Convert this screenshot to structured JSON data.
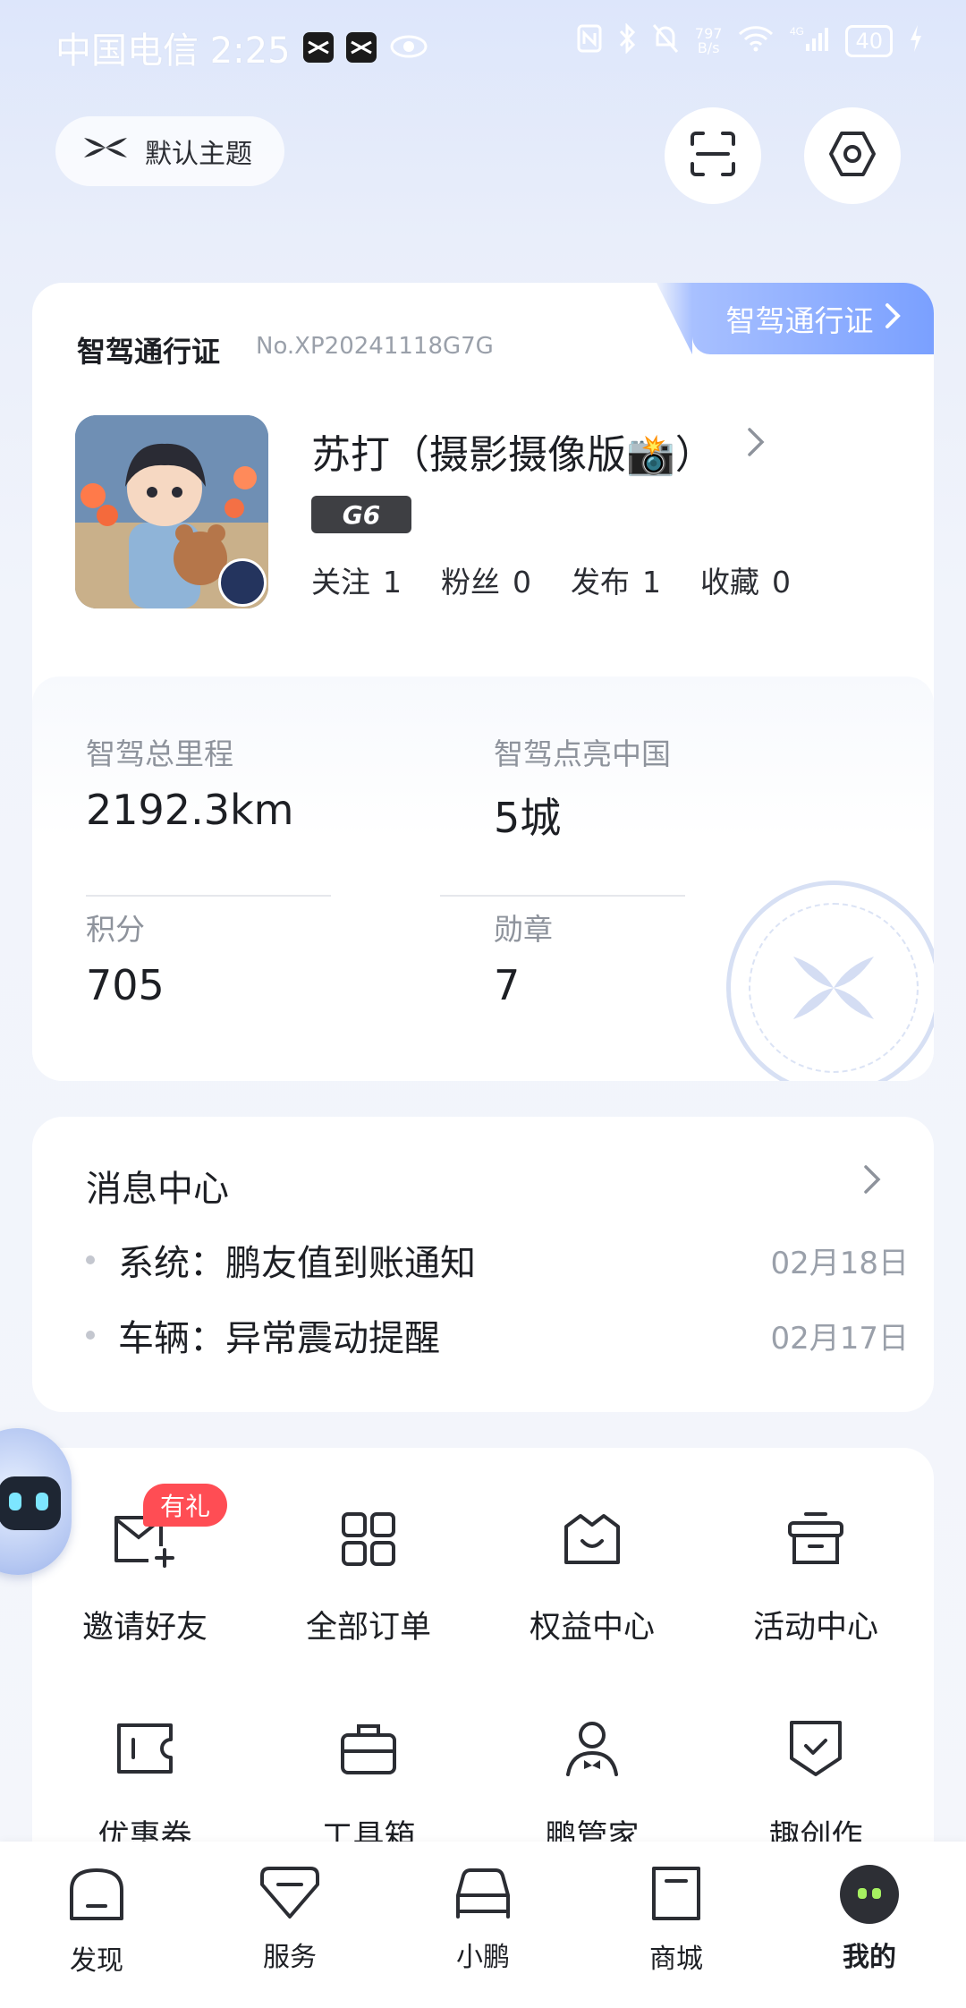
{
  "status_bar": {
    "carrier_time": "中国电信 2:25",
    "net_speed": "797\nB/s",
    "battery": "40"
  },
  "header": {
    "theme_label": "默认主题"
  },
  "passport": {
    "title": "智驾通行证",
    "number": "No.XP20241118G7G",
    "tab_label": "智驾通行证",
    "user_name": "苏打（摄影摄像版📸）",
    "car_tag": "G6",
    "social": [
      {
        "label": "关注",
        "value": "1"
      },
      {
        "label": "粉丝",
        "value": "0"
      },
      {
        "label": "发布",
        "value": "1"
      },
      {
        "label": "收藏",
        "value": "0"
      }
    ],
    "stats": [
      {
        "label": "智驾总里程",
        "value": "2192.3km"
      },
      {
        "label": "智驾点亮中国",
        "value": "5城"
      },
      {
        "label": "积分",
        "value": "705"
      },
      {
        "label": "勋章",
        "value": "7"
      }
    ]
  },
  "messages": {
    "title": "消息中心",
    "items": [
      {
        "text": "系统：鹏友值到账通知",
        "date": "02月18日"
      },
      {
        "text": "车辆：异常震动提醒",
        "date": "02月17日"
      }
    ]
  },
  "services": {
    "gift_badge": "有礼",
    "items": [
      {
        "label": "邀请好友",
        "icon": "invite-mail-icon"
      },
      {
        "label": "全部订单",
        "icon": "grid-orders-icon"
      },
      {
        "label": "权益中心",
        "icon": "basket-icon"
      },
      {
        "label": "活动中心",
        "icon": "gift-box-icon"
      },
      {
        "label": "优惠券",
        "icon": "coupon-icon"
      },
      {
        "label": "工具箱",
        "icon": "toolbox-icon"
      },
      {
        "label": "鹏管家",
        "icon": "butler-icon"
      },
      {
        "label": "趣创作",
        "icon": "shield-check-icon"
      }
    ]
  },
  "bottom_nav": {
    "items": [
      {
        "label": "发现",
        "icon": "discover-icon"
      },
      {
        "label": "服务",
        "icon": "service-icon"
      },
      {
        "label": "小鹏",
        "icon": "car-icon"
      },
      {
        "label": "商城",
        "icon": "mall-icon"
      },
      {
        "label": "我的",
        "icon": "profile-avatar-icon",
        "active": true
      }
    ]
  },
  "colors": {
    "accent": "#7aa0ff",
    "badge_red": "#ff4d54",
    "car_tag_bg": "#3e3f43"
  }
}
